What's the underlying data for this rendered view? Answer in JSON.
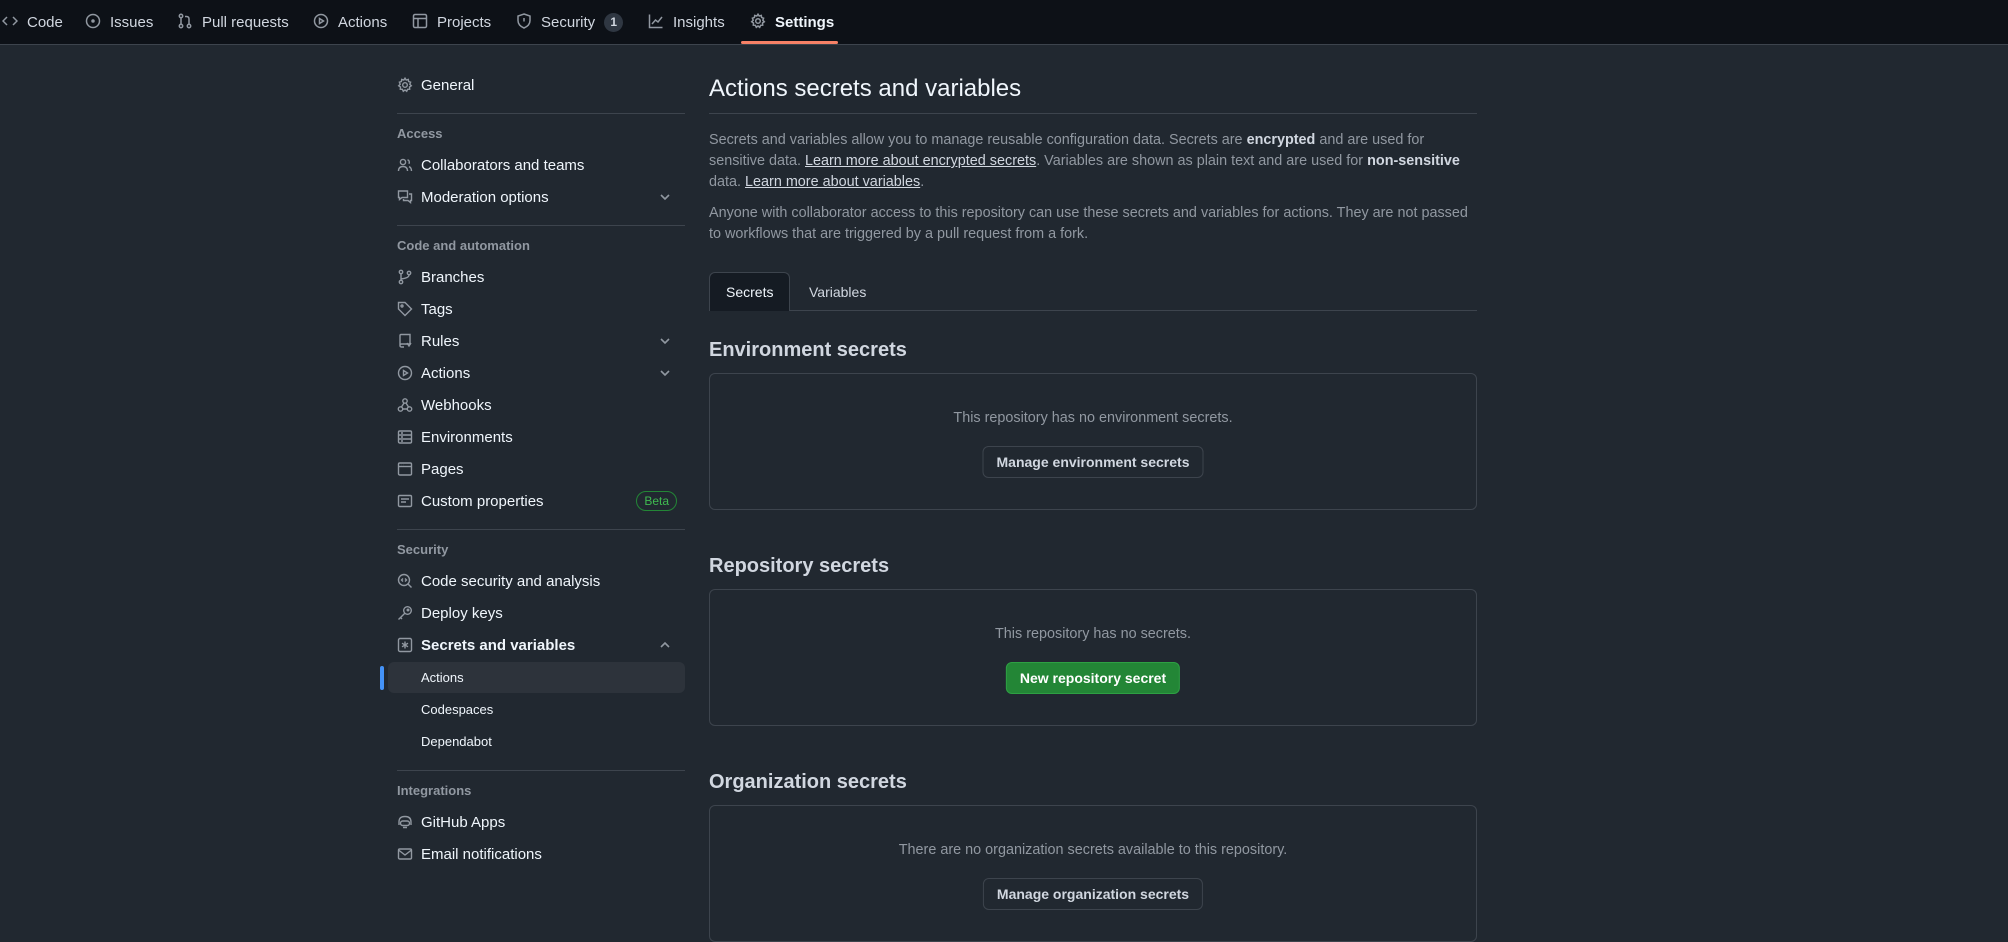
{
  "topnav": {
    "tabs": [
      {
        "label": "Code",
        "icon": "code-icon"
      },
      {
        "label": "Issues",
        "icon": "issue-opened-icon"
      },
      {
        "label": "Pull requests",
        "icon": "git-pull-request-icon"
      },
      {
        "label": "Actions",
        "icon": "play-icon"
      },
      {
        "label": "Projects",
        "icon": "table-icon"
      },
      {
        "label": "Security",
        "icon": "shield-icon",
        "counter": "1"
      },
      {
        "label": "Insights",
        "icon": "graph-icon"
      },
      {
        "label": "Settings",
        "icon": "gear-icon",
        "selected": true
      }
    ],
    "accent_color": "#f78166"
  },
  "sidebar": {
    "general": "General",
    "groups": {
      "access": "Access",
      "code_automation": "Code and automation",
      "security": "Security",
      "integrations": "Integrations"
    },
    "items": {
      "collaborators": "Collaborators and teams",
      "moderation": "Moderation options",
      "branches": "Branches",
      "tags": "Tags",
      "rules": "Rules",
      "actions": "Actions",
      "webhooks": "Webhooks",
      "environments": "Environments",
      "pages": "Pages",
      "custom_properties": "Custom properties",
      "code_security": "Code security and analysis",
      "deploy_keys": "Deploy keys",
      "secrets_variables": "Secrets and variables",
      "github_apps": "GitHub Apps",
      "email_notifications": "Email notifications"
    },
    "beta_label": "Beta",
    "sub_items": {
      "actions": "Actions",
      "codespaces": "Codespaces",
      "dependabot": "Dependabot"
    },
    "active_color": "#4493f8"
  },
  "main": {
    "title": "Actions secrets and variables",
    "intro": {
      "p1_a": "Secrets and variables allow you to manage reusable configuration data. Secrets are ",
      "p1_b": "encrypted",
      "p1_c": " and are used for sensitive data. ",
      "p1_link1": "Learn more about encrypted secrets",
      "p1_d": ". Variables are shown as plain text and are used for ",
      "p1_e": "non-sensitive",
      "p1_f": " data. ",
      "p1_link2": "Learn more about variables",
      "p1_g": ".",
      "p2": "Anyone with collaborator access to this repository can use these secrets and variables for actions. They are not passed to workflows that are triggered by a pull request from a fork."
    },
    "tabs": {
      "secrets": "Secrets",
      "variables": "Variables"
    },
    "env": {
      "title": "Environment secrets",
      "message": "This repository has no environment secrets.",
      "button": "Manage environment secrets"
    },
    "repo": {
      "title": "Repository secrets",
      "message": "This repository has no secrets.",
      "button": "New repository secret"
    },
    "org": {
      "title": "Organization secrets",
      "message": "There are no organization secrets available to this repository.",
      "button": "Manage organization secrets"
    },
    "primary_color": "#238636"
  }
}
